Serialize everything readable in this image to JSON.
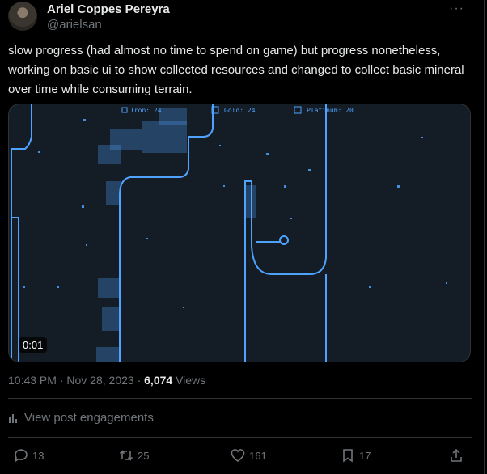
{
  "author": {
    "name": "Ariel Coppes Pereyra",
    "handle": "@arielsan"
  },
  "post": {
    "text": "slow progress (had almost no time to spend on game) but progress nonetheless, working on basic ui to show collected resources and changed to collect basic mineral over time while consuming terrain."
  },
  "media": {
    "timestamp": "0:01",
    "hud": {
      "iron": "Iron: 24",
      "gold": "Gold: 24",
      "platinum": "Platinum: 20"
    },
    "colors": {
      "bg": "#141c25",
      "terrain": "#4fa3ff"
    }
  },
  "meta": {
    "time": "10:43 PM",
    "sep1": " · ",
    "date": "Nov 28, 2023",
    "sep2": " · ",
    "views_count": "6,074",
    "views_label": " Views"
  },
  "engagements_link": "View post engagements",
  "actions": {
    "replies": "13",
    "reposts": "25",
    "likes": "161",
    "bookmarks": "17"
  }
}
